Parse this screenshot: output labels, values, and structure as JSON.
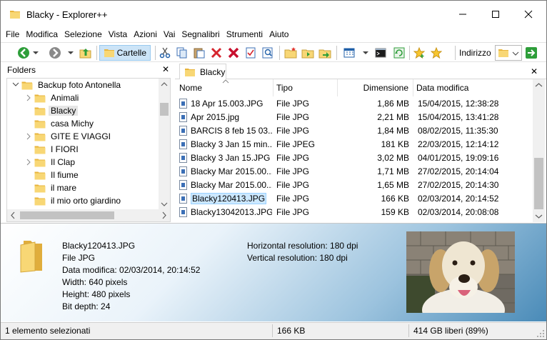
{
  "window": {
    "title": "Blacky - Explorer++"
  },
  "menu": [
    "File",
    "Modifica",
    "Selezione",
    "Vista",
    "Azioni",
    "Vai",
    "Segnalibri",
    "Strumenti",
    "Aiuto"
  ],
  "toolbar": {
    "folders_label": "Cartelle",
    "address_label": "Indirizzo"
  },
  "folders": {
    "title": "Folders",
    "items": [
      {
        "label": "Backup foto Antonella",
        "expander": "expanded"
      },
      {
        "label": "Animali",
        "expander": "collapsed"
      },
      {
        "label": "Blacky",
        "expander": "none",
        "selected": true
      },
      {
        "label": "casa Michy",
        "expander": "none"
      },
      {
        "label": "GITE E VIAGGI",
        "expander": "collapsed"
      },
      {
        "label": "I FIORI",
        "expander": "none"
      },
      {
        "label": "Il Clap",
        "expander": "collapsed"
      },
      {
        "label": "Il fiume",
        "expander": "none"
      },
      {
        "label": "il mare",
        "expander": "none"
      },
      {
        "label": "il mio orto giardino",
        "expander": "none"
      }
    ]
  },
  "tab": {
    "label": "Blacky"
  },
  "list": {
    "columns": {
      "name": "Nome",
      "type": "Tipo",
      "size": "Dimensione",
      "modified": "Data modifica"
    },
    "rows": [
      {
        "name": "18 Apr 15.003.JPG",
        "type": "File JPG",
        "size": "1,86 MB",
        "modified": "15/04/2015, 12:38:28"
      },
      {
        "name": "Apr 2015.jpg",
        "type": "File JPG",
        "size": "2,21 MB",
        "modified": "15/04/2015, 13:41:28"
      },
      {
        "name": "BARCIS 8 feb 15 03....",
        "type": "File JPG",
        "size": "1,84 MB",
        "modified": "08/02/2015, 11:35:30"
      },
      {
        "name": "Blacky 3 Jan 15 min...",
        "type": "File JPEG",
        "size": "181 KB",
        "modified": "22/03/2015, 12:14:12"
      },
      {
        "name": "Blacky 3 Jan 15.JPG",
        "type": "File JPG",
        "size": "3,02 MB",
        "modified": "04/01/2015, 19:09:16"
      },
      {
        "name": "Blacky Mar 2015.00...",
        "type": "File JPG",
        "size": "1,71 MB",
        "modified": "27/02/2015, 20:14:04"
      },
      {
        "name": "Blacky Mar 2015.00...",
        "type": "File JPG",
        "size": "1,65 MB",
        "modified": "27/02/2015, 20:14:30"
      },
      {
        "name": "Blacky120413.JPG",
        "type": "File JPG",
        "size": "166 KB",
        "modified": "02/03/2014, 20:14:52",
        "selected": true
      },
      {
        "name": "Blacky13042013.JPG",
        "type": "File JPG",
        "size": "159 KB",
        "modified": "02/03/2014, 20:08:08"
      }
    ]
  },
  "preview": {
    "filename": "Blacky120413.JPG",
    "type": "File JPG",
    "modified": "Data modifica: 02/03/2014, 20:14:52",
    "width": "Width: 640 pixels",
    "height": "Height: 480 pixels",
    "bit_depth": "Bit depth: 24",
    "h_res": "Horizontal resolution: 180 dpi",
    "v_res": "Vertical resolution: 180 dpi"
  },
  "status": {
    "selection": "1 elemento selezionati",
    "size": "166 KB",
    "free": "414 GB liberi (89%)"
  },
  "colors": {
    "selection": "#cce8ff",
    "folder": "#f8d775",
    "accent": "#0078d7"
  }
}
